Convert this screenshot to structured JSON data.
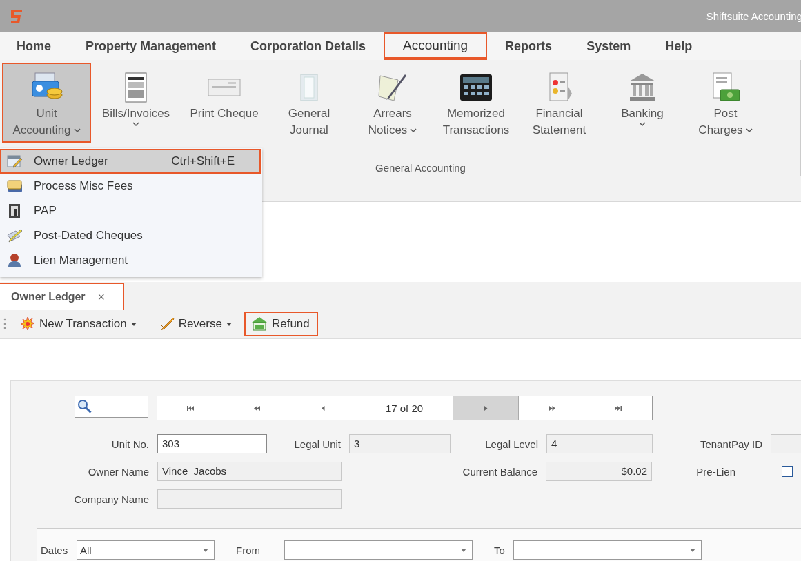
{
  "title_bar": {
    "app_title": "Shiftsuite Accounting"
  },
  "menu": [
    {
      "label": "Home",
      "selected": false,
      "highlighted": false
    },
    {
      "label": "Property Management",
      "selected": false,
      "highlighted": false
    },
    {
      "label": "Corporation Details",
      "selected": false,
      "highlighted": false
    },
    {
      "label": "Accounting",
      "selected": true,
      "highlighted": true
    },
    {
      "label": "Reports",
      "selected": false,
      "highlighted": false
    },
    {
      "label": "System",
      "selected": false,
      "highlighted": false
    },
    {
      "label": "Help",
      "selected": false,
      "highlighted": false
    }
  ],
  "ribbon": {
    "group_label": "General Accounting",
    "buttons": [
      {
        "lines": [
          "Unit",
          "Accounting"
        ],
        "dropdown": true,
        "caret_below": false,
        "selected": true,
        "highlighted": true
      },
      {
        "lines": [
          "Bills/Invoices"
        ],
        "dropdown": true,
        "caret_below": true,
        "selected": false,
        "highlighted": false
      },
      {
        "lines": [
          "Print Cheque"
        ],
        "dropdown": false,
        "selected": false,
        "highlighted": false
      },
      {
        "lines": [
          "General",
          "Journal"
        ],
        "dropdown": false,
        "selected": false,
        "highlighted": false
      },
      {
        "lines": [
          "Arrears",
          "Notices"
        ],
        "dropdown": true,
        "caret_below": false,
        "selected": false,
        "highlighted": false
      },
      {
        "lines": [
          "Memorized",
          "Transactions"
        ],
        "dropdown": false,
        "selected": false,
        "highlighted": false
      },
      {
        "lines": [
          "Financial",
          "Statement"
        ],
        "dropdown": false,
        "selected": false,
        "highlighted": false
      },
      {
        "lines": [
          "Banking"
        ],
        "dropdown": true,
        "caret_below": true,
        "selected": false,
        "highlighted": false
      },
      {
        "lines": [
          "Post",
          "Charges"
        ],
        "dropdown": true,
        "caret_below": false,
        "selected": false,
        "highlighted": false
      }
    ]
  },
  "dropdown": {
    "items": [
      {
        "label": "Owner Ledger",
        "shortcut": "Ctrl+Shift+E",
        "selected": true,
        "highlighted": true
      },
      {
        "label": "Process Misc Fees",
        "selected": false,
        "highlighted": false
      },
      {
        "label": "PAP",
        "selected": false,
        "highlighted": false
      },
      {
        "label": "Post-Dated Cheques",
        "selected": false,
        "highlighted": false
      },
      {
        "label": "Lien Management",
        "selected": false,
        "highlighted": false
      }
    ]
  },
  "doc_tab": {
    "label": "Owner Ledger",
    "close": "×",
    "highlighted": true
  },
  "toolbar": [
    {
      "label": "New Transaction",
      "dropdown": true,
      "highlighted": false
    },
    {
      "label": "Reverse",
      "dropdown": true,
      "highlighted": false
    },
    {
      "label": "Refund",
      "dropdown": false,
      "highlighted": true
    }
  ],
  "navigator": {
    "position": "17 of 20",
    "buttons": [
      {
        "kind": "first",
        "selected": false
      },
      {
        "kind": "prev_page",
        "selected": false
      },
      {
        "kind": "prev",
        "selected": false
      },
      {
        "kind": "position",
        "selected": false
      },
      {
        "kind": "next",
        "selected": true
      },
      {
        "kind": "next_page",
        "selected": false
      },
      {
        "kind": "last",
        "selected": false
      }
    ]
  },
  "form": {
    "fields": [
      {
        "label": "Unit No.",
        "value": "303",
        "kind": "input"
      },
      {
        "label": "Legal Unit",
        "value": "3",
        "kind": "readonly"
      },
      {
        "label": "Legal Level",
        "value": "4",
        "kind": "readonly"
      },
      {
        "label": "TenantPay ID",
        "kind": "readonly"
      },
      {
        "label": "Owner Name",
        "value": "Vince  Jacobs",
        "kind": "readonly"
      },
      {
        "label": "Current Balance",
        "value": "$0.02",
        "kind": "amount"
      },
      {
        "label": "Pre-Lien",
        "kind": "checkbox",
        "checked": false
      },
      {
        "label": "Company Name",
        "kind": "readonly"
      }
    ]
  },
  "filter": [
    {
      "label": "Dates",
      "value": "All"
    },
    {
      "label": "From"
    },
    {
      "label": "To"
    }
  ]
}
